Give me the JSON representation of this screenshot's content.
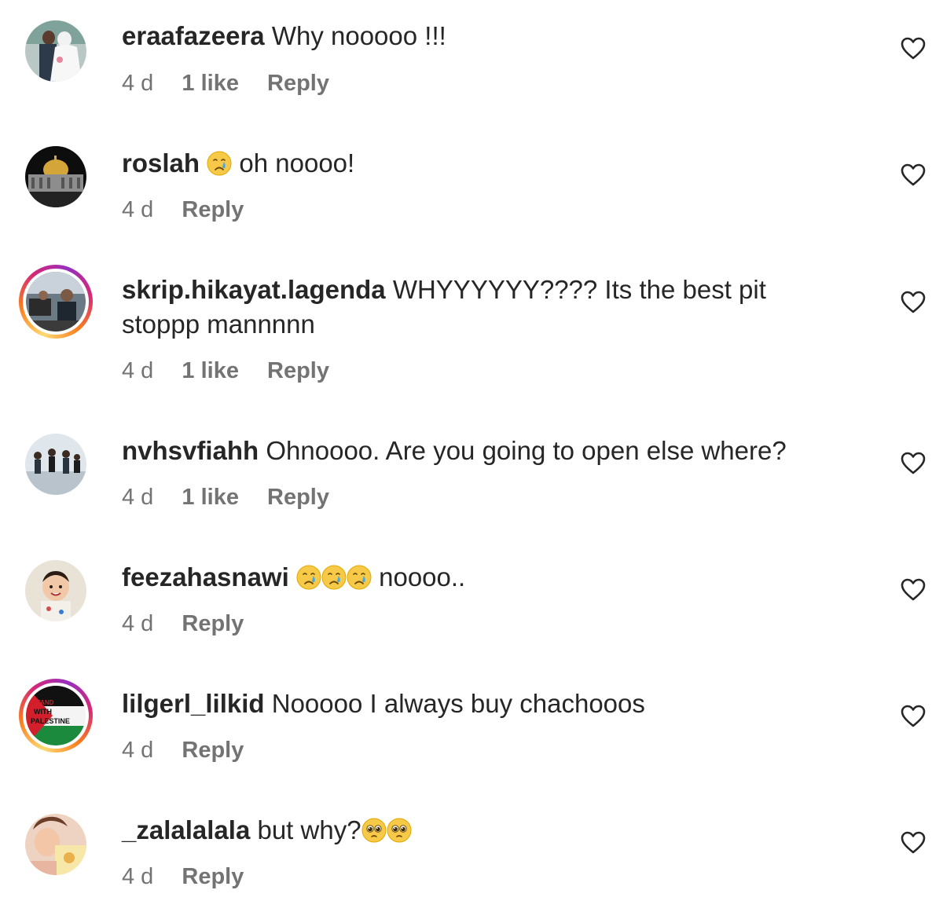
{
  "comments": [
    {
      "username": "eraafazeera",
      "text": "Why nooooo !!!",
      "time": "4 d",
      "likes": "1 like",
      "reply": "Reply"
    },
    {
      "username": "roslah",
      "emoji": "crying-face",
      "text": "oh noooo!",
      "time": "4 d",
      "reply": "Reply"
    },
    {
      "username": "skrip.hikayat.lagenda",
      "text": "WHYYYYYY???? Its the best pit stoppp mannnnn",
      "time": "4 d",
      "likes": "1 like",
      "reply": "Reply"
    },
    {
      "username": "nvhsvfiahh",
      "text": "Ohnoooo. Are you going to open else where?",
      "time": "4 d",
      "likes": "1 like",
      "reply": "Reply"
    },
    {
      "username": "feezahasnawi",
      "emoji": "crying-face x3",
      "text": "noooo..",
      "time": "4 d",
      "reply": "Reply"
    },
    {
      "username": "lilgerl_lilkid",
      "text": "Nooooo I always buy chachooos",
      "time": "4 d",
      "reply": "Reply",
      "avatar_text": [
        "I STAND",
        "WITH",
        "PALESTINE"
      ]
    },
    {
      "username": "_zalalalala",
      "text": "but why?",
      "emoji": "pleading-face x2",
      "time": "4 d",
      "reply": "Reply"
    }
  ],
  "icons": {
    "heart": "heart-outline-icon"
  },
  "colors": {
    "text": "#262626",
    "secondary": "#737373",
    "story_ring": "#d62976"
  }
}
